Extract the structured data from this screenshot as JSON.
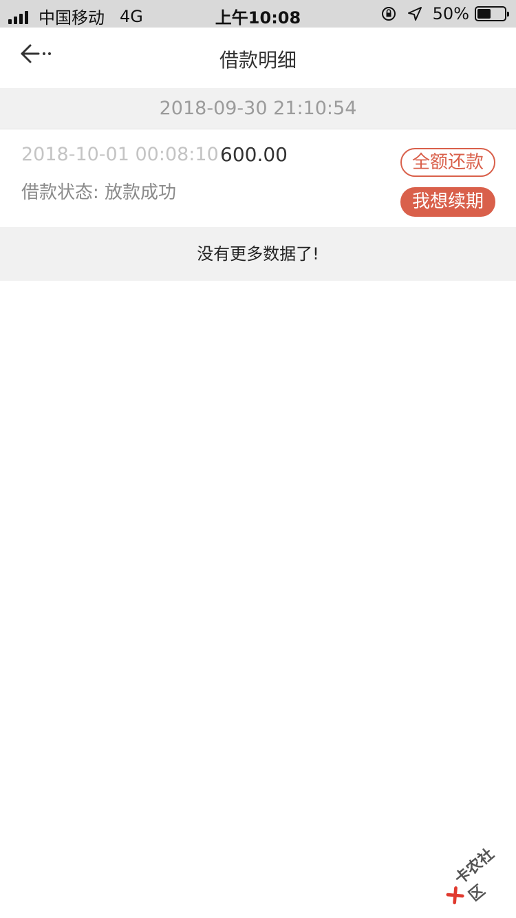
{
  "status_bar": {
    "carrier": "中国移动",
    "network": "4G",
    "time": "上午10:08",
    "battery": "50%",
    "battery_level": 0.5
  },
  "nav": {
    "title": "借款明细"
  },
  "date_header": "2018-09-30 21:10:54",
  "loan": {
    "time": "2018-10-01 00:08:10",
    "amount": "600.00",
    "status": "借款状态: 放款成功",
    "repay_label": "全额还款",
    "renew_label": "我想续期"
  },
  "no_more": "没有更多数据了!",
  "watermark": "卡农社区",
  "colors": {
    "accent": "#d9604b",
    "status_bar_bg": "#d9d9d9",
    "section_bg": "#f1f1f1"
  }
}
